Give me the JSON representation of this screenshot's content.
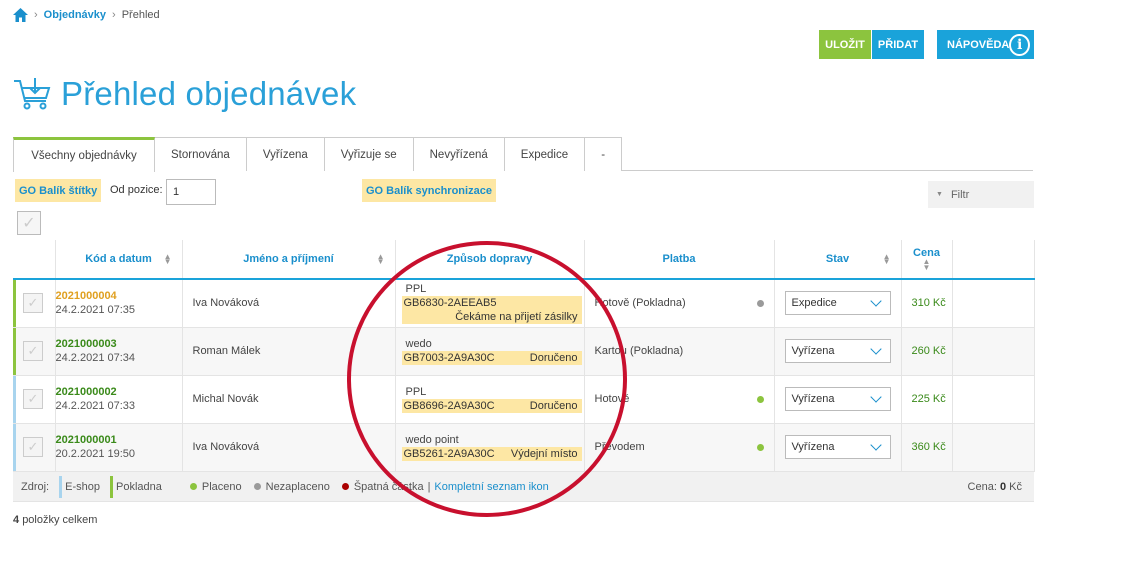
{
  "breadcrumb": {
    "link": "Objednávky",
    "current": "Přehled"
  },
  "toolbar": {
    "save": "ULOŽIT",
    "add": "PŘIDAT",
    "help": "NÁPOVĚDA"
  },
  "page_title": "Přehled objednávek",
  "tabs": [
    "Všechny objednávky",
    "Stornována",
    "Vyřízena",
    "Vyřizuje se",
    "Nevyřízená",
    "Expedice",
    "-"
  ],
  "actions": {
    "labels_btn": "GO Balík štítky",
    "from_position_label": "Od pozice:",
    "from_position_value": "1",
    "sync_btn": "GO Balík synchronizace",
    "filter": "Filtr"
  },
  "columns": [
    "Kód a datum",
    "Jméno a příjmení",
    "Způsob dopravy",
    "Platba",
    "Stav",
    "Cena"
  ],
  "orders": [
    {
      "code": "2021000004",
      "date": "24.2.2021 07:35",
      "name": "Iva Nováková",
      "carrier": "PPL",
      "tracking": "GB6830-2AEEAB5",
      "status_text": "Čekáme na přijetí zásilky",
      "payment": "Hotově (Pokladna)",
      "payment_dot": "#9a9a9a",
      "state": "Expedice",
      "price": "310 Kč"
    },
    {
      "code": "2021000003",
      "date": "24.2.2021 07:34",
      "name": "Roman Málek",
      "carrier": "wedo",
      "tracking": "GB7003-2A9A30C",
      "status_text": "Doručeno",
      "payment": "Kartou (Pokladna)",
      "payment_dot": "",
      "state": "Vyřízena",
      "price": "260 Kč"
    },
    {
      "code": "2021000002",
      "date": "24.2.2021 07:33",
      "name": "Michal Novák",
      "carrier": "PPL",
      "tracking": "GB8696-2A9A30C",
      "status_text": "Doručeno",
      "payment": "Hotově",
      "payment_dot": "#8cc43e",
      "state": "Vyřízena",
      "price": "225 Kč"
    },
    {
      "code": "2021000001",
      "date": "20.2.2021 19:50",
      "name": "Iva Nováková",
      "carrier": "wedo point",
      "tracking": "GB5261-2A9A30C",
      "status_text": "Výdejní místo",
      "payment": "Převodem",
      "payment_dot": "#8cc43e",
      "state": "Vyřízena",
      "price": "360 Kč"
    }
  ],
  "footer": {
    "source_label": "Zdroj:",
    "source_eshop": "E-shop",
    "source_pokladna": "Pokladna",
    "paid": "Placeno",
    "unpaid": "Nezaplaceno",
    "bad_amount": "Špatná částka",
    "separator": "|",
    "icons_link": "Kompletní seznam ikon",
    "price_label": "Cena:",
    "price_value": "0",
    "price_unit": "Kč"
  },
  "total": {
    "count": "4",
    "label": "položky celkem"
  },
  "colors": {
    "accent_blue": "#1aa3da",
    "accent_green": "#8cc43e",
    "highlight_yellow": "#fde7a4",
    "annotation_red": "#c8102e"
  }
}
